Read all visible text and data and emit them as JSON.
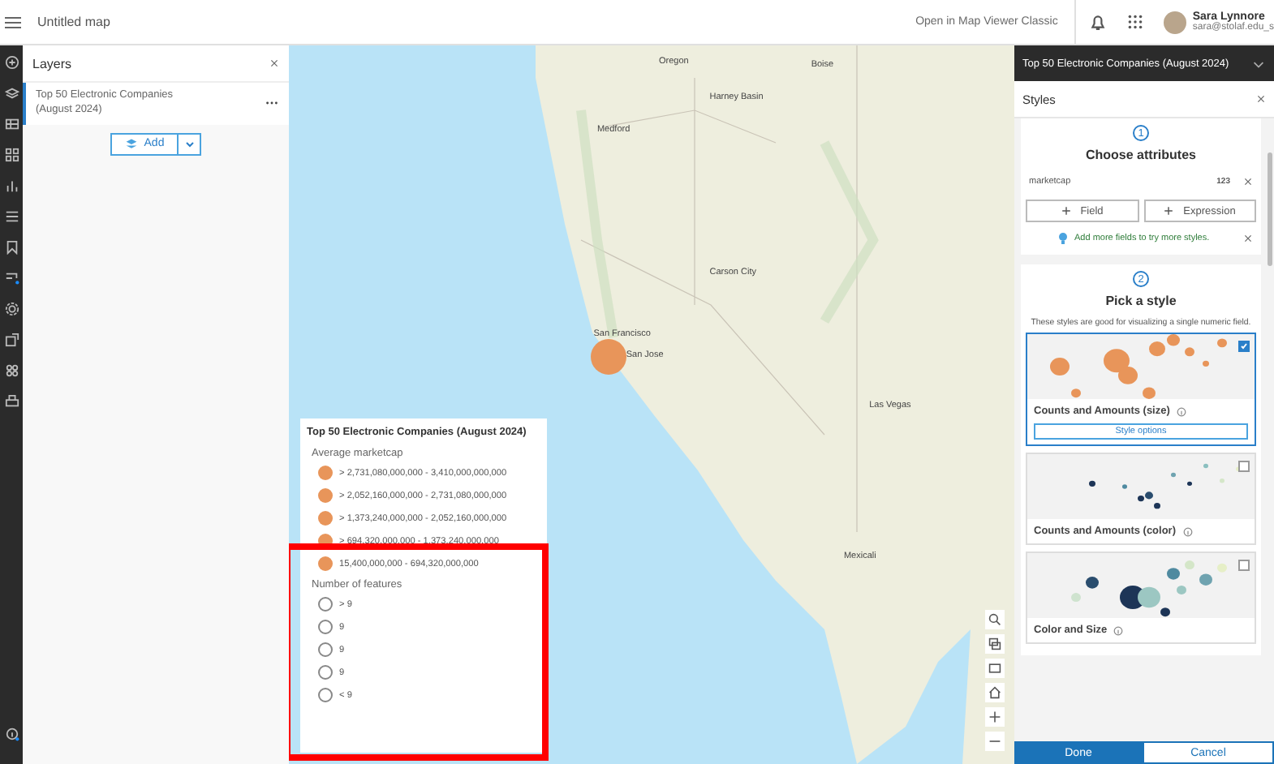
{
  "header": {
    "title": "Untitled map",
    "classic_link": "Open in Map Viewer Classic",
    "user": {
      "name": "Sara Lynnore",
      "email": "sara@stolaf.edu_s"
    }
  },
  "layers_panel": {
    "title": "Layers",
    "layers": [
      {
        "name": "Top 50 Electronic Companies (August 2024)",
        "selected": true
      }
    ],
    "add_button": "Add"
  },
  "map": {
    "labels": [
      "Oregon",
      "Medford",
      "Harney Basin",
      "Boise",
      "Carson City",
      "San Francisco",
      "San Jose",
      "Las Vegas",
      "Mexicali"
    ],
    "legend": {
      "title": "Top 50 Electronic Companies (August 2024)",
      "sections": [
        {
          "title": "Average marketcap",
          "kind": "size",
          "items": [
            "> 2,731,080,000,000 - 3,410,000,000,000",
            "> 2,052,160,000,000 - 2,731,080,000,000",
            "> 1,373,240,000,000 - 2,052,160,000,000",
            "> 694,320,000,000 - 1,373,240,000,000",
            "15,400,000,000 - 694,320,000,000"
          ]
        },
        {
          "title": "Number of features",
          "kind": "count",
          "items": [
            "> 9",
            "9",
            "9",
            "9",
            "< 9"
          ]
        }
      ]
    }
  },
  "styles_panel": {
    "layer_title": "Top 50 Electronic Companies (August 2024)",
    "title": "Styles",
    "step1": {
      "number": "1",
      "title": "Choose attributes",
      "field": {
        "name": "marketcap",
        "type": "123"
      },
      "buttons": [
        "Field",
        "Expression"
      ],
      "tip": "Add more fields to try more styles."
    },
    "step2": {
      "number": "2",
      "title": "Pick a style",
      "description": "These styles are good for visualizing a single numeric field.",
      "styles": [
        {
          "kind": "size",
          "name": "Counts and Amounts (size)",
          "selected": true,
          "options_button": "Style options"
        },
        {
          "kind": "color",
          "name": "Counts and Amounts (color)",
          "selected": false
        },
        {
          "kind": "color-size",
          "name": "Color and Size",
          "selected": false
        }
      ]
    },
    "footer": [
      "Done",
      "Cancel"
    ]
  }
}
